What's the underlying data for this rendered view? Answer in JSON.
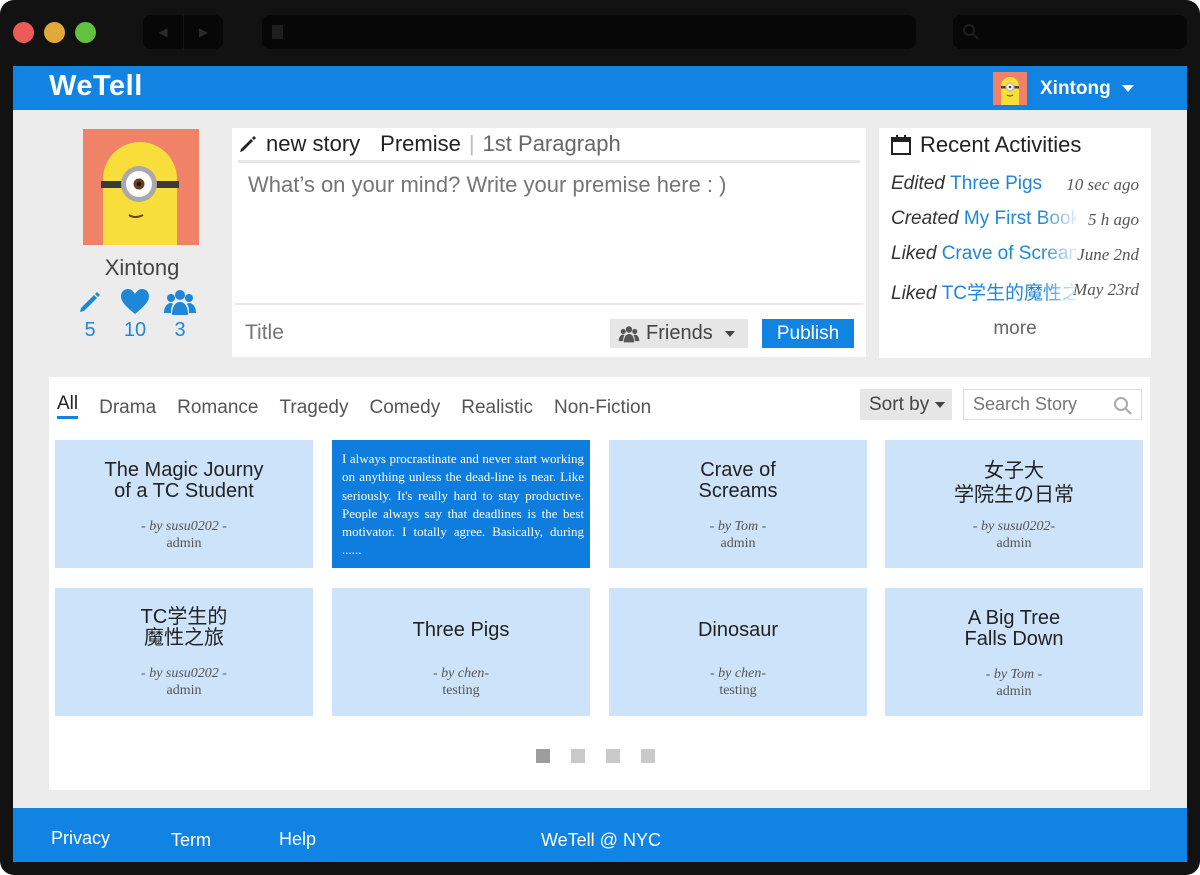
{
  "app": {
    "name": "WeTell"
  },
  "header": {
    "user_name": "Xintong"
  },
  "profile": {
    "name": "Xintong",
    "stats": [
      {
        "icon": "pencil-icon",
        "value": "5"
      },
      {
        "icon": "heart-icon",
        "value": "10"
      },
      {
        "icon": "users-icon",
        "value": "3"
      }
    ]
  },
  "new_story": {
    "title_label": "new story",
    "tab_premise": "Premise",
    "tab_separator": "|",
    "tab_paragraph": "1st Paragraph",
    "placeholder": "What’s on your mind? Write your premise here : )",
    "title_placeholder": "Title",
    "audience": "Friends",
    "publish_label": "Publish"
  },
  "recent": {
    "heading": "Recent Activities",
    "items": [
      {
        "action": "Edited",
        "target": "Three Pigs",
        "time": "10 sec ago"
      },
      {
        "action": "Created",
        "target": "My First Book",
        "time": "5 h ago"
      },
      {
        "action": "Liked",
        "target": "Crave of Screams",
        "time": "June 2nd"
      },
      {
        "action": "Liked",
        "target": "TC学生的魔性之旅",
        "time": "May 23rd"
      }
    ],
    "more_label": "more"
  },
  "genres": [
    "All",
    "Drama",
    "Romance",
    "Tragedy",
    "Comedy",
    "Realistic",
    "Non-Fiction"
  ],
  "active_genre": "All",
  "sort_label": "Sort by",
  "search_placeholder": "Search Story",
  "stories": [
    {
      "title": "The Magic Journy\nof a TC Student",
      "by": "- by susu0202 -",
      "role": "admin"
    },
    {
      "excerpt": "I always procrastinate and never start working on anything unless the dead-line is near. Like seriously. It's really hard to stay productive. People always say that deadlines is the best motivator. I totally agree. Basically, during ......"
    },
    {
      "title": "Crave of\nScreams",
      "by": "- by Tom -",
      "role": "admin"
    },
    {
      "title": "女子大\n学院生の日常",
      "by": "- by susu0202-",
      "role": "admin"
    },
    {
      "title": "TC学生的\n魔性之旅",
      "by": "- by susu0202 -",
      "role": "admin"
    },
    {
      "title": "Three Pigs",
      "by": "- by chen-",
      "role": "testing"
    },
    {
      "title": "Dinosaur",
      "by": "- by chen-",
      "role": "testing"
    },
    {
      "title": "A Big Tree\nFalls Down",
      "by": "- by Tom -",
      "role": "admin"
    }
  ],
  "pagination": {
    "pages": 4,
    "current": 1
  },
  "footer": {
    "privacy": "Privacy",
    "term": "Term",
    "help": "Help",
    "copyright": "WeTell @ NYC"
  },
  "colors": {
    "brand": "#1183e3",
    "card": "#cde3f9",
    "card_highlight": "#0e7ddd",
    "link": "#1e87d8",
    "avatar_bg": "#ef8267",
    "minion_yellow": "#f7de3a"
  }
}
